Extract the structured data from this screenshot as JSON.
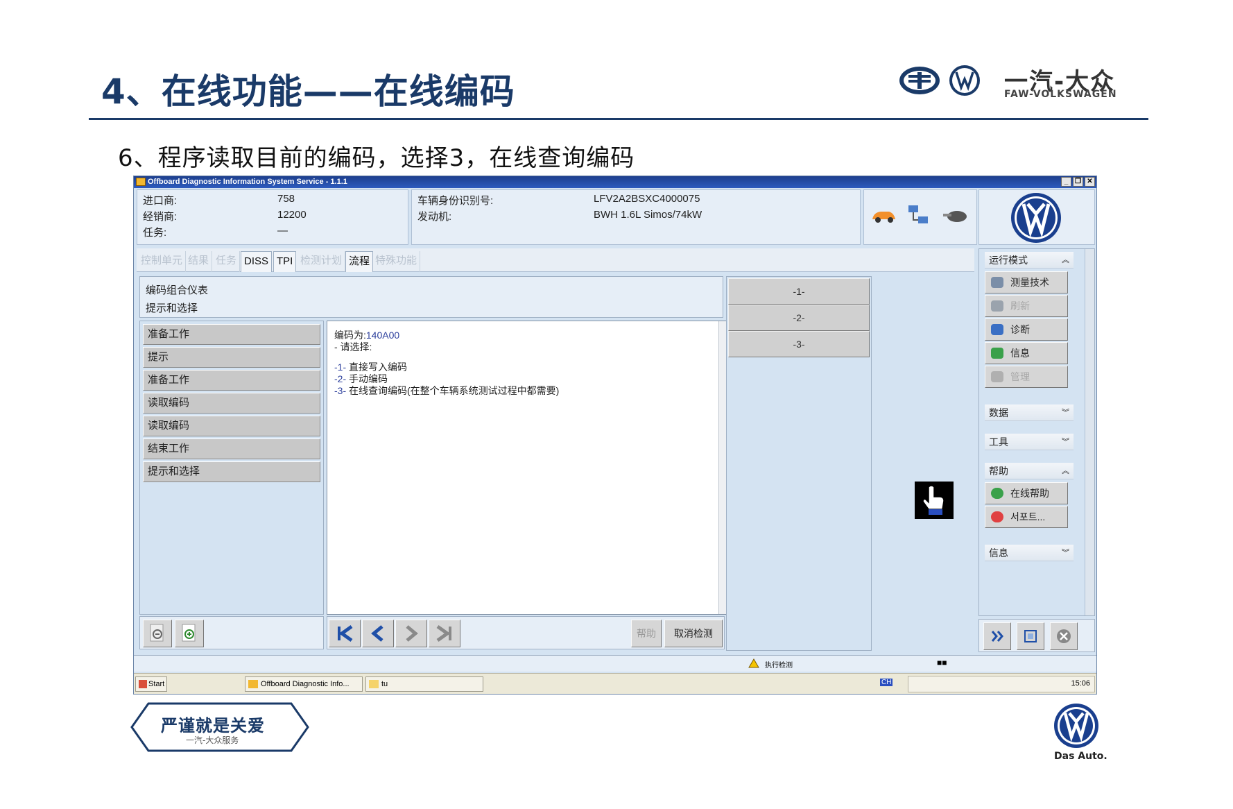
{
  "slide": {
    "title": "4、在线功能——在线编码",
    "subtitle": "6、程序读取目前的编码，选择3，在线查询编码",
    "brand_cn": "一汽-大众",
    "brand_en": "FAW-VOLKSWAGEN",
    "footer_slogan": "严谨就是关爱",
    "footer_sub": "一汽-大众服务",
    "das_auto": "Das Auto."
  },
  "window": {
    "title": "Offboard Diagnostic Information System Service - 1.1.1",
    "controls": [
      "_",
      "❐",
      "✕"
    ],
    "info_left": [
      {
        "label": "进口商:",
        "value": "758"
      },
      {
        "label": "经销商:",
        "value": "12200"
      },
      {
        "label": "任务:",
        "value": "—"
      }
    ],
    "info_right": [
      {
        "label": "车辆身份识别号:",
        "value": "LFV2A2BSXC4000075"
      },
      {
        "label": "发动机:",
        "value": "BWH 1.6L Simos/74kW"
      }
    ],
    "tabs": [
      {
        "label": "控制单元",
        "active": false
      },
      {
        "label": "结果",
        "active": false
      },
      {
        "label": "任务",
        "active": false
      },
      {
        "label": "DISS",
        "active": true
      },
      {
        "label": "TPI",
        "active": true
      },
      {
        "label": "检测计划",
        "active": false
      },
      {
        "label": "流程",
        "active": true
      },
      {
        "label": "特殊功能",
        "active": false
      }
    ],
    "process_header": {
      "line1": "编码组合仪表",
      "line2": "提示和选择"
    },
    "steps": [
      "准备工作",
      "提示",
      "准备工作",
      "读取编码",
      "读取编码",
      "结束工作",
      "提示和选择"
    ],
    "text": {
      "code_label": "编码为:",
      "code_value": "140A00",
      "prompt": "- 请选择:",
      "options": [
        {
          "num": "-1-",
          "text": "直接写入编码"
        },
        {
          "num": "-2-",
          "text": "手动编码"
        },
        {
          "num": "-3-",
          "text": "在线查询编码(在整个车辆系统测试过程中都需要)"
        }
      ]
    },
    "choices": [
      "-1-",
      "-2-",
      "-3-"
    ],
    "buttons": {
      "help": "帮助",
      "cancel": "取消检测"
    },
    "sidebar": {
      "mode_group": "运行模式",
      "mode_items": [
        {
          "label": "测量技术",
          "enabled": true,
          "icon": "gauge-icon",
          "color": "#7a8ea8"
        },
        {
          "label": "刷新",
          "enabled": false,
          "icon": "refresh-icon",
          "color": "#9aa3ad"
        },
        {
          "label": "诊断",
          "enabled": true,
          "icon": "stethoscope-icon",
          "color": "#3a6fc4"
        },
        {
          "label": "信息",
          "enabled": true,
          "icon": "books-icon",
          "color": "#3aa14a"
        },
        {
          "label": "管理",
          "enabled": false,
          "icon": "admin-gear-icon",
          "color": "#b0b0b0"
        }
      ],
      "data_group": "数据",
      "tools_group": "工具",
      "help_group": "帮助",
      "help_items": [
        {
          "label": "在线帮助",
          "icon": "help-icon",
          "color": "#3aa14a"
        },
        {
          "label": "서포트...",
          "icon": "lifebuoy-icon",
          "color": "#e04040"
        }
      ],
      "info_group": "信息"
    },
    "status": {
      "text": "执行检测",
      "indicator": "■■"
    },
    "taskbar": {
      "start": "Start",
      "items": [
        "Offboard Diagnostic Info...",
        "tu"
      ],
      "lang": "CH",
      "clock": "15:06"
    }
  }
}
